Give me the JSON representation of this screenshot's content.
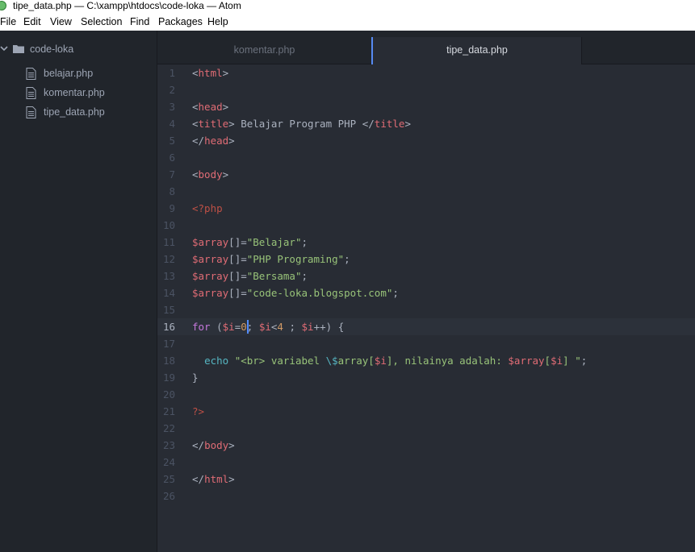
{
  "window": {
    "title": "tipe_data.php — C:\\xampp\\htdocs\\code-loka — Atom"
  },
  "menu": [
    "File",
    "Edit",
    "View",
    "Selection",
    "Find",
    "Packages",
    "Help"
  ],
  "tree": {
    "root": "code-loka",
    "files": [
      "belajar.php",
      "komentar.php",
      "tipe_data.php"
    ]
  },
  "tabs": [
    {
      "label": "komentar.php",
      "active": false
    },
    {
      "label": "tipe_data.php",
      "active": true
    }
  ],
  "editor": {
    "current_line": 16,
    "line_numbers": [
      "1",
      "2",
      "3",
      "4",
      "5",
      "6",
      "7",
      "8",
      "9",
      "10",
      "11",
      "12",
      "13",
      "14",
      "15",
      "16",
      "17",
      "18",
      "19",
      "20",
      "21",
      "22",
      "23",
      "24",
      "25",
      "26"
    ],
    "lines": [
      [
        [
          "<",
          "t-plain"
        ],
        [
          "html",
          "t-red"
        ],
        [
          ">",
          "t-plain"
        ]
      ],
      [],
      [
        [
          "<",
          "t-plain"
        ],
        [
          "head",
          "t-red"
        ],
        [
          ">",
          "t-plain"
        ]
      ],
      [
        [
          "<",
          "t-plain"
        ],
        [
          "title",
          "t-red"
        ],
        [
          "> Belajar Program PHP </",
          "t-plain"
        ],
        [
          "title",
          "t-red"
        ],
        [
          ">",
          "t-plain"
        ]
      ],
      [
        [
          "</",
          "t-plain"
        ],
        [
          "head",
          "t-red"
        ],
        [
          ">",
          "t-plain"
        ]
      ],
      [],
      [
        [
          "<",
          "t-plain"
        ],
        [
          "body",
          "t-red"
        ],
        [
          ">",
          "t-plain"
        ]
      ],
      [],
      [
        [
          "<?php",
          "t-red2"
        ]
      ],
      [],
      [
        [
          "$",
          "t-red"
        ],
        [
          "array",
          "t-red"
        ],
        [
          "[]=",
          "t-plain"
        ],
        [
          "\"Belajar\"",
          "t-green"
        ],
        [
          ";",
          "t-plain"
        ]
      ],
      [
        [
          "$",
          "t-red"
        ],
        [
          "array",
          "t-red"
        ],
        [
          "[]=",
          "t-plain"
        ],
        [
          "\"PHP Programing\"",
          "t-green"
        ],
        [
          ";",
          "t-plain"
        ]
      ],
      [
        [
          "$",
          "t-red"
        ],
        [
          "array",
          "t-red"
        ],
        [
          "[]=",
          "t-plain"
        ],
        [
          "\"Bersama\"",
          "t-green"
        ],
        [
          ";",
          "t-plain"
        ]
      ],
      [
        [
          "$",
          "t-red"
        ],
        [
          "array",
          "t-red"
        ],
        [
          "[]=",
          "t-plain"
        ],
        [
          "\"code-loka.blogspot.com\"",
          "t-green"
        ],
        [
          ";",
          "t-plain"
        ]
      ],
      [],
      [
        [
          "for",
          "t-purple"
        ],
        [
          " (",
          "t-plain"
        ],
        [
          "$i",
          "t-red"
        ],
        [
          "=",
          "t-plain"
        ],
        [
          "0",
          "t-orange"
        ],
        [
          "; ",
          "t-plain"
        ],
        [
          "$i",
          "t-red"
        ],
        [
          "<",
          "t-plain"
        ],
        [
          "4",
          "t-orange"
        ],
        [
          " ; ",
          "t-plain"
        ],
        [
          "$i",
          "t-red"
        ],
        [
          "++) {",
          "t-plain"
        ]
      ],
      [],
      [
        [
          "  ",
          "t-plain"
        ],
        [
          "echo",
          "t-cyan"
        ],
        [
          " ",
          "t-plain"
        ],
        [
          "\"<br> variabel ",
          "t-green"
        ],
        [
          "\\$",
          "t-cyan"
        ],
        [
          "array[",
          "t-green"
        ],
        [
          "$i",
          "t-red"
        ],
        [
          "], nilainya adalah: ",
          "t-green"
        ],
        [
          "$array",
          "t-red"
        ],
        [
          "[",
          "t-green"
        ],
        [
          "$i",
          "t-red"
        ],
        [
          "] \"",
          "t-green"
        ],
        [
          ";",
          "t-plain"
        ]
      ],
      [
        [
          "}",
          "t-plain"
        ]
      ],
      [],
      [
        [
          "?>",
          "t-red2"
        ]
      ],
      [],
      [
        [
          "</",
          "t-plain"
        ],
        [
          "body",
          "t-red"
        ],
        [
          ">",
          "t-plain"
        ]
      ],
      [],
      [
        [
          "</",
          "t-plain"
        ],
        [
          "html",
          "t-red"
        ],
        [
          ">",
          "t-plain"
        ]
      ],
      []
    ]
  },
  "colors": {
    "editor_bg": "#282c34",
    "tree_bg": "#21252b",
    "tab_active_border": "#568af2",
    "cursor": "#528bff"
  }
}
